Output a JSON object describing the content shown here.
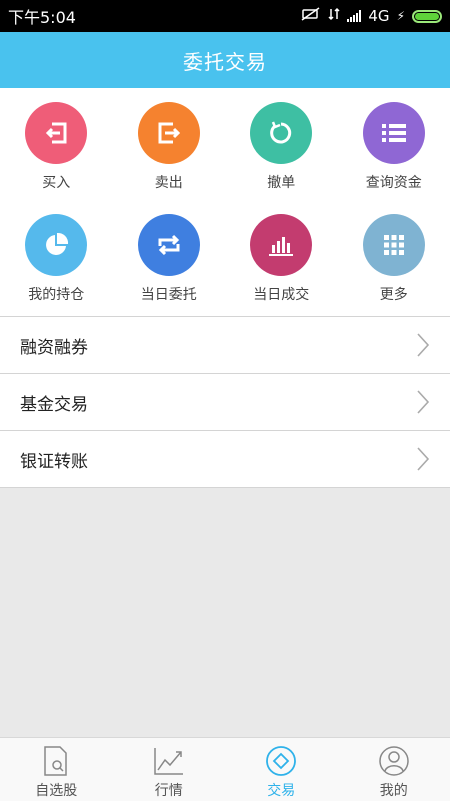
{
  "status_bar": {
    "time": "下午5:04",
    "network": "4G"
  },
  "header": {
    "title": "委托交易"
  },
  "grid": [
    {
      "label": "买入",
      "icon": "buy-icon",
      "color": "#ef5d78"
    },
    {
      "label": "卖出",
      "icon": "sell-icon",
      "color": "#f5822f"
    },
    {
      "label": "撤单",
      "icon": "cancel-order-icon",
      "color": "#3ebfa3"
    },
    {
      "label": "查询资金",
      "icon": "list-icon",
      "color": "#8f67d4"
    },
    {
      "label": "我的持仓",
      "icon": "pie-chart-icon",
      "color": "#55b9ec"
    },
    {
      "label": "当日委托",
      "icon": "repeat-icon",
      "color": "#3f7fe0"
    },
    {
      "label": "当日成交",
      "icon": "bar-chart-icon",
      "color": "#c33c6f"
    },
    {
      "label": "更多",
      "icon": "grid-icon",
      "color": "#7fb3d2"
    }
  ],
  "menu": [
    {
      "label": "融资融券"
    },
    {
      "label": "基金交易"
    },
    {
      "label": "银证转账"
    }
  ],
  "tabs": [
    {
      "label": "自选股",
      "icon": "watchlist-icon",
      "active": false
    },
    {
      "label": "行情",
      "icon": "market-chart-icon",
      "active": false
    },
    {
      "label": "交易",
      "icon": "trade-icon",
      "active": true
    },
    {
      "label": "我的",
      "icon": "profile-icon",
      "active": false
    }
  ],
  "colors": {
    "accent": "#49c2ee",
    "tab_active": "#2fb2ea"
  }
}
